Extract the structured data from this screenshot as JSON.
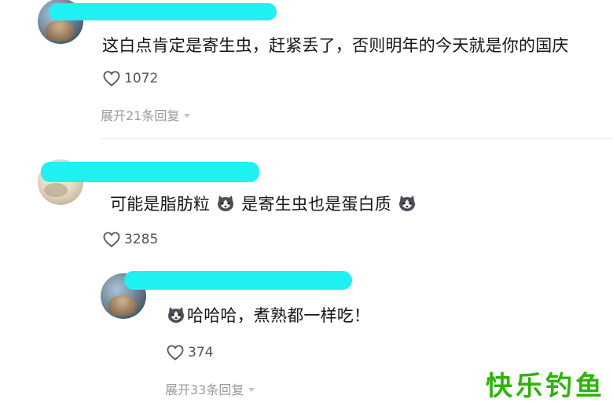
{
  "comments": [
    {
      "text": "这白点肯定是寄生虫，赶紧丢了，否则明年的今天就是你的国庆",
      "likes": "1072",
      "expand_label": "展开21条回复"
    },
    {
      "text_part1": "可能是脂肪粒",
      "text_part2": "是寄生虫也是蛋白质",
      "likes": "3285",
      "reply": {
        "text": "哈哈哈，煮熟都一样吃！",
        "likes": "374",
        "expand_label": "展开33条回复"
      }
    }
  ],
  "watermark": "快乐钓鱼",
  "colors": {
    "name_mask": "#1ff0f2",
    "watermark": "#2bb600"
  },
  "icons": [
    "heart-icon",
    "husky-emoji-icon",
    "caret-down-icon"
  ]
}
